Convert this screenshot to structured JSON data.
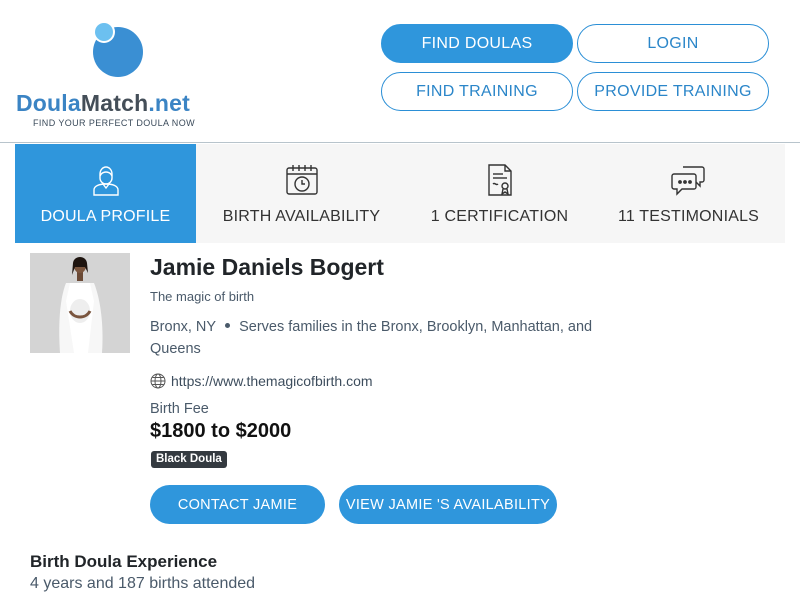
{
  "brand": {
    "name_part1": "Doula",
    "name_part2": "Match",
    "name_part3": ".net",
    "tagline": "FIND YOUR PERFECT DOULA NOW",
    "colors": {
      "primary": "#2f96dc",
      "logo_blue": "#3b84c4",
      "logo_dark": "#444e58"
    }
  },
  "nav": {
    "find_doulas": "FIND DOULAS",
    "login": "LOGIN",
    "find_training": "FIND TRAINING",
    "provide_training": "PROVIDE TRAINING"
  },
  "tabs": [
    {
      "label": "DOULA PROFILE",
      "icon": "doula-person-icon",
      "active": true
    },
    {
      "label": "BIRTH AVAILABILITY",
      "icon": "calendar-clock-icon",
      "active": false
    },
    {
      "label": "1 CERTIFICATION",
      "icon": "certificate-icon",
      "active": false
    },
    {
      "label": "11 TESTIMONIALS",
      "icon": "chat-bubbles-icon",
      "active": false
    }
  ],
  "profile": {
    "name": "Jamie Daniels Bogert",
    "tagline": "The magic of birth",
    "city": "Bronx, NY",
    "serves": "Serves families in the Bronx, Brooklyn, Manhattan, and Queens",
    "website": "https://www.themagicofbirth.com",
    "fee_label": "Birth Fee",
    "fee_value": "$1800 to $2000",
    "badge": "Black Doula",
    "contact_button": "CONTACT JAMIE",
    "availability_button": "VIEW JAMIE 'S AVAILABILITY"
  },
  "experience": {
    "title": "Birth Doula Experience",
    "value": "4 years and 187 births attended"
  }
}
